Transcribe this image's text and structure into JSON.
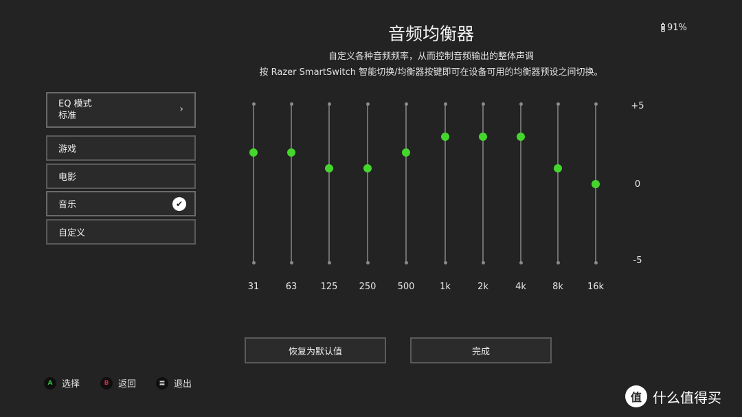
{
  "header": {
    "title": "音频均衡器",
    "subtitle_line1": "自定义各种音频频率，从而控制音频输出的整体声调",
    "subtitle_line2": "按 Razer SmartSwitch 智能切换/均衡器按键即可在设备可用的均衡器预设之间切换。",
    "battery": "91%"
  },
  "mode": {
    "label": "EQ 模式",
    "value": "标准",
    "chevron": "›"
  },
  "presets": [
    {
      "label": "游戏",
      "selected": false
    },
    {
      "label": "电影",
      "selected": false
    },
    {
      "label": "音乐",
      "selected": true
    },
    {
      "label": "自定义",
      "selected": false
    }
  ],
  "check_glyph": "✔",
  "chart_data": {
    "type": "line",
    "categories": [
      "31",
      "63",
      "125",
      "250",
      "500",
      "1k",
      "2k",
      "4k",
      "8k",
      "16k"
    ],
    "values": [
      2,
      2,
      1,
      1,
      2,
      3,
      3,
      3,
      1,
      0
    ],
    "ylim": [
      -5,
      5
    ],
    "y_ticks": [
      "+5",
      "0",
      "-5"
    ],
    "grid": false
  },
  "buttons": {
    "reset": "恢复为默认值",
    "done": "完成"
  },
  "hints": [
    {
      "key": "A",
      "label": "选择"
    },
    {
      "key": "B",
      "label": "返回"
    },
    {
      "key": "≡",
      "label": "退出"
    }
  ],
  "watermark": {
    "icon": "值",
    "text": "什么值得买"
  },
  "colors": {
    "accent": "#44d62c",
    "background": "#232323"
  }
}
